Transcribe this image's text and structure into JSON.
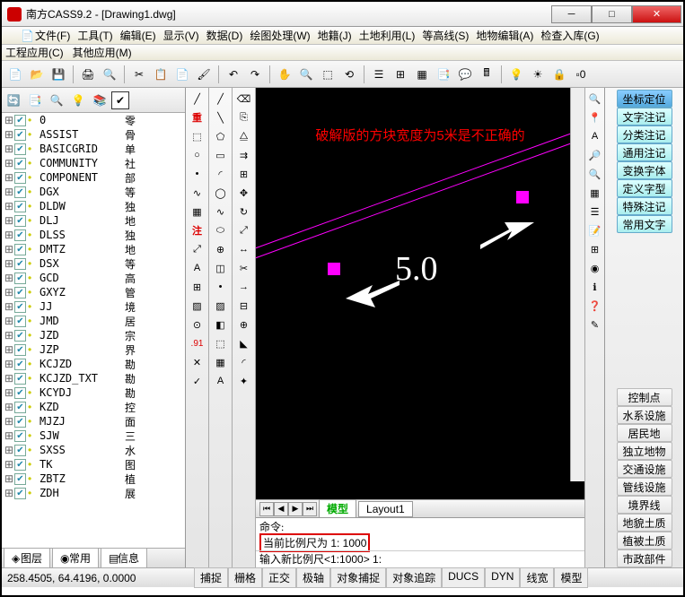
{
  "window": {
    "title": "南方CASS9.2 - [Drawing1.dwg]"
  },
  "menu": {
    "file": "文件(F)",
    "tool": "工具(T)",
    "edit": "编辑(E)",
    "view": "显示(V)",
    "data": "数据(D)",
    "draw": "绘图处理(W)",
    "cadastre": "地籍(J)",
    "land": "土地利用(L)",
    "contour": "等高线(S)",
    "topo": "地物编辑(A)",
    "check": "检查入库(G)",
    "eng": "工程应用(C)",
    "other": "其他应用(M)"
  },
  "layers": [
    {
      "name": "0",
      "desc": "零"
    },
    {
      "name": "ASSIST",
      "desc": "骨"
    },
    {
      "name": "BASICGRID",
      "desc": "单"
    },
    {
      "name": "COMMUNITY",
      "desc": "社"
    },
    {
      "name": "COMPONENT",
      "desc": "部"
    },
    {
      "name": "DGX",
      "desc": "等"
    },
    {
      "name": "DLDW",
      "desc": "独"
    },
    {
      "name": "DLJ",
      "desc": "地"
    },
    {
      "name": "DLSS",
      "desc": "独"
    },
    {
      "name": "DMTZ",
      "desc": "地"
    },
    {
      "name": "DSX",
      "desc": "等"
    },
    {
      "name": "GCD",
      "desc": "高"
    },
    {
      "name": "GXYZ",
      "desc": "管"
    },
    {
      "name": "JJ",
      "desc": "境"
    },
    {
      "name": "JMD",
      "desc": "居"
    },
    {
      "name": "JZD",
      "desc": "宗"
    },
    {
      "name": "JZP",
      "desc": "界"
    },
    {
      "name": "KCJZD",
      "desc": "勘"
    },
    {
      "name": "KCJZD_TXT",
      "desc": "勘"
    },
    {
      "name": "KCYDJ",
      "desc": "勘"
    },
    {
      "name": "KZD",
      "desc": "控"
    },
    {
      "name": "MJZJ",
      "desc": "面"
    },
    {
      "name": "SJW",
      "desc": "三"
    },
    {
      "name": "SXSS",
      "desc": "水"
    },
    {
      "name": "TK",
      "desc": "图"
    },
    {
      "name": "ZBTZ",
      "desc": "植"
    },
    {
      "name": "ZDH",
      "desc": "展"
    }
  ],
  "left_tabs": {
    "layer": "图层",
    "common": "常用",
    "info": "信息"
  },
  "canvas": {
    "annotation": "破解版的方块宽度为5米是不正确的",
    "dimension": "5.0"
  },
  "model_tabs": {
    "model": "模型",
    "layout1": "Layout1"
  },
  "cmd": {
    "label": "命令:",
    "history": "当前比例尺为  1: 1000",
    "prompt": "输入新比例尺<1:1000>  1:"
  },
  "right_panel": {
    "top": [
      "坐标定位",
      "文字注记",
      "分类注记",
      "通用注记",
      "变换字体",
      "定义字型",
      "特殊注记",
      "常用文字"
    ],
    "bottom": [
      "控制点",
      "水系设施",
      "居民地",
      "独立地物",
      "交通设施",
      "管线设施",
      "境界线",
      "地貌土质",
      "植被土质",
      "市政部件"
    ]
  },
  "status": {
    "coords": "258.4505, 64.4196, 0.0000",
    "btns": [
      "捕捉",
      "栅格",
      "正交",
      "极轴",
      "对象捕捉",
      "对象追踪",
      "DUCS",
      "DYN",
      "线宽",
      "模型"
    ]
  },
  "vtool_red": {
    "zhong": "重",
    "zhu": "注",
    "dot91": ".91"
  }
}
